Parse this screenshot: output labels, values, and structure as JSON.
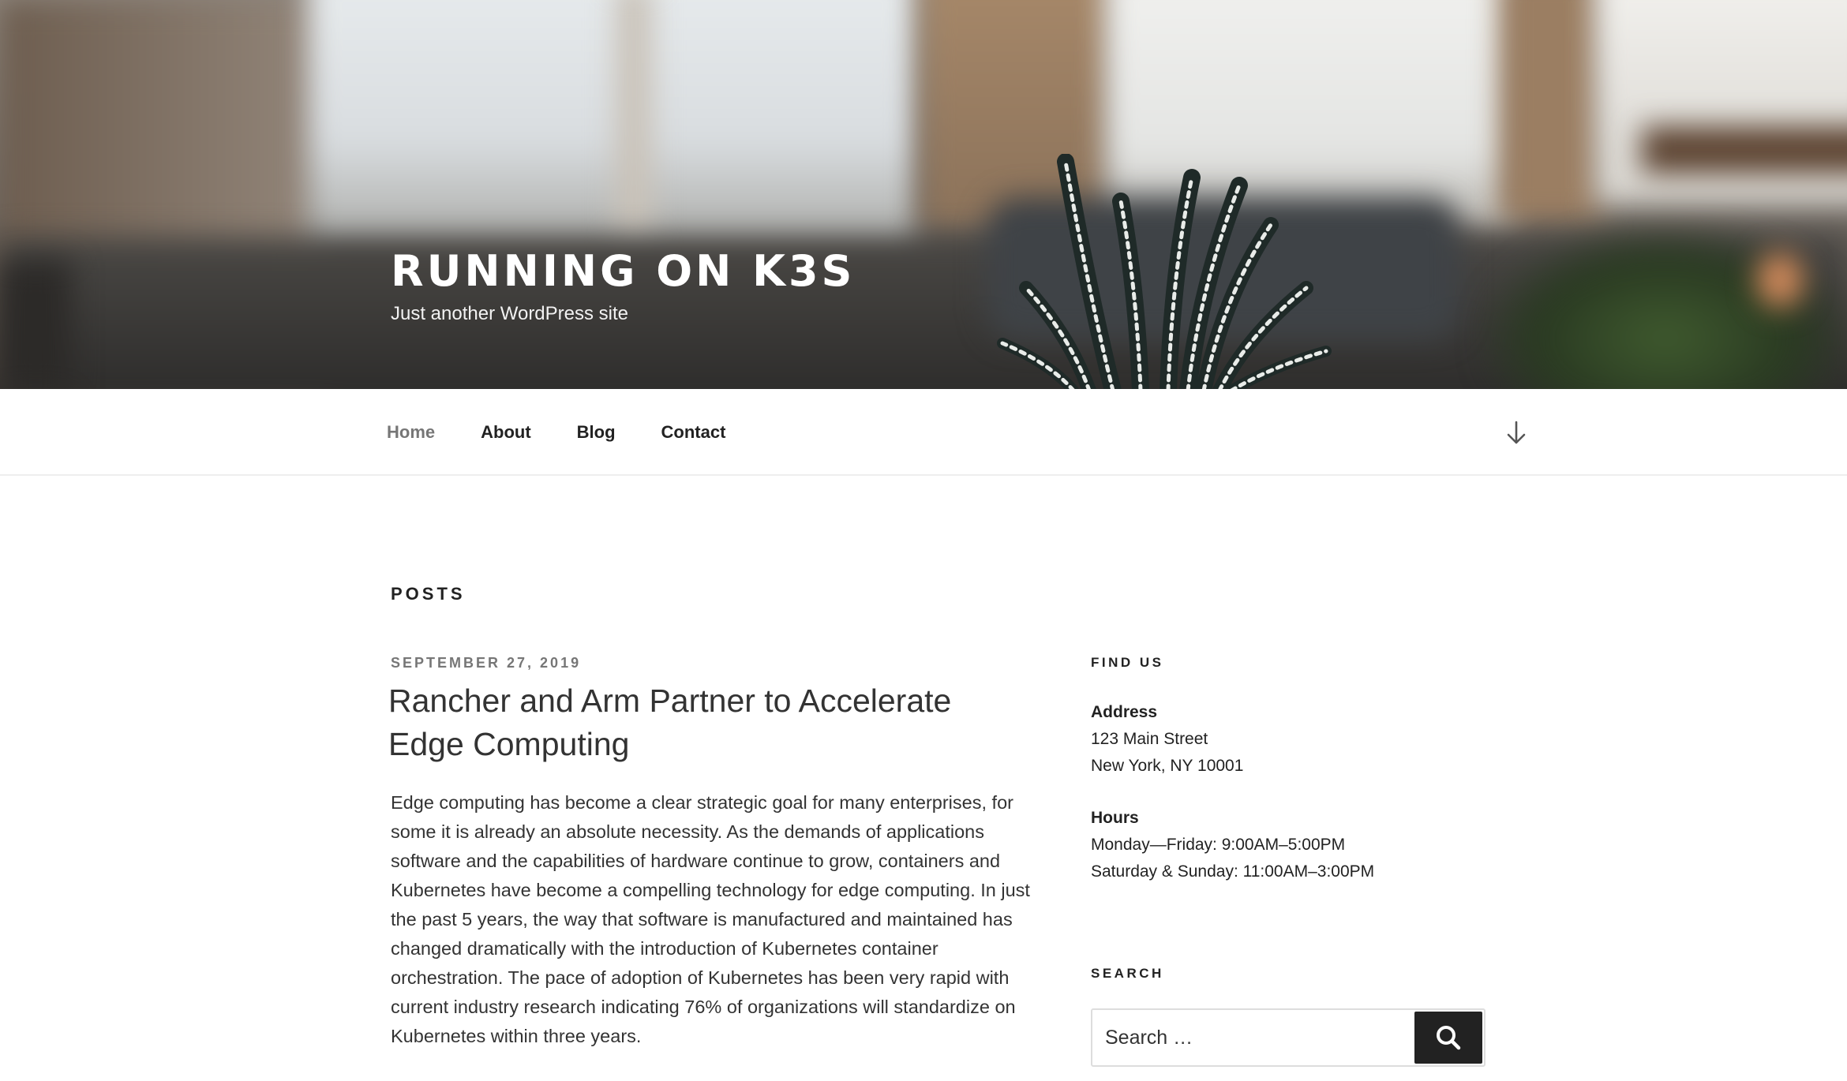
{
  "site": {
    "title": "RUNNING ON K3S",
    "tagline": "Just another WordPress site"
  },
  "nav": {
    "items": [
      {
        "label": "Home",
        "current": true
      },
      {
        "label": "About",
        "current": false
      },
      {
        "label": "Blog",
        "current": false
      },
      {
        "label": "Contact",
        "current": false
      }
    ],
    "scroll_icon": "arrow-down-icon"
  },
  "main": {
    "page_title": "POSTS",
    "post": {
      "date": "SEPTEMBER 27, 2019",
      "title": "Rancher and Arm Partner to Accelerate Edge Computing",
      "excerpt": "Edge computing has become a clear strategic goal for many enterprises, for some it is already an absolute necessity. As the demands of applications software and the capabilities of hardware continue to grow, containers and Kubernetes have become a compelling technology for edge computing. In just the past 5 years, the way that software is manufactured and maintained has changed dramatically with the introduction of Kubernetes container orchestration. The pace of adoption of Kubernetes has been very rapid with current industry research indicating 76% of organizations will standardize on Kubernetes within three years."
    }
  },
  "sidebar": {
    "find_us": {
      "title": "FIND US",
      "address_label": "Address",
      "address_line1": "123 Main Street",
      "address_line2": "New York, NY 10001",
      "hours_label": "Hours",
      "hours_line1": "Monday—Friday: 9:00AM–5:00PM",
      "hours_line2": "Saturday & Sunday: 11:00AM–3:00PM"
    },
    "search": {
      "title": "SEARCH",
      "placeholder": "Search …",
      "button_icon": "search-icon"
    }
  },
  "colors": {
    "text": "#222222",
    "muted": "#767676",
    "search_button": "#222222"
  }
}
